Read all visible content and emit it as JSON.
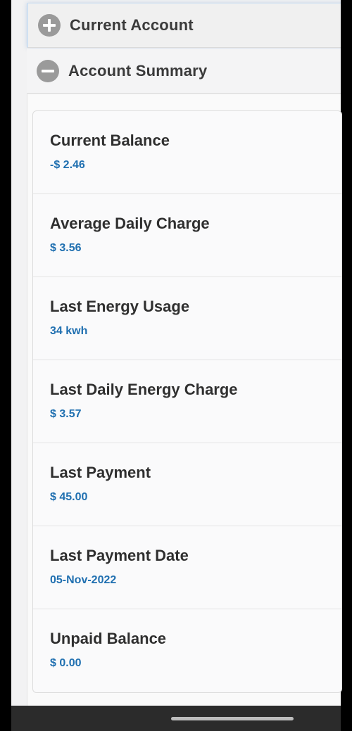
{
  "accordion": {
    "current_account": {
      "title": "Current Account",
      "icon": "plus-circle-icon"
    },
    "account_summary": {
      "title": "Account Summary",
      "icon": "minus-circle-icon"
    }
  },
  "summary": {
    "items": [
      {
        "label": "Current Balance",
        "value": "-$ 2.46"
      },
      {
        "label": "Average Daily Charge",
        "value": "$ 3.56"
      },
      {
        "label": "Last Energy Usage",
        "value": "34 kwh"
      },
      {
        "label": "Last Daily Energy Charge",
        "value": "$ 3.57"
      },
      {
        "label": "Last Payment",
        "value": "$ 45.00"
      },
      {
        "label": "Last Payment Date",
        "value": "05-Nov-2022"
      },
      {
        "label": "Unpaid Balance",
        "value": "$ 0.00"
      }
    ]
  },
  "colors": {
    "value_blue": "#1f6fb0",
    "label_dark": "#2f2f2f",
    "icon_gray": "#9a9a9a"
  }
}
